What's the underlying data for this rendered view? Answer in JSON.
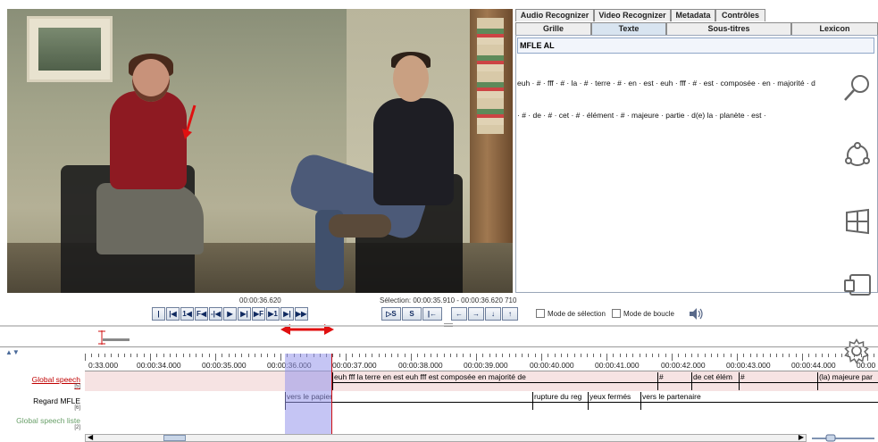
{
  "right_panel": {
    "tabs_top": [
      "Audio Recognizer",
      "Video Recognizer",
      "Metadata",
      "Contrôles"
    ],
    "tabs_second": [
      "Grille",
      "Texte",
      "Sous-titres",
      "Lexicon"
    ],
    "active_tab": "Texte",
    "tier_name": "MFLE AL",
    "transcript_lines": [
      "euh · # · fff · # · la · # · terre · # · en · est · euh · fff · # · est · composée · en · majorité · d",
      "· # · de · # · cet · # · élément · # · majeure · partie · d(e) la · planète · est ·"
    ]
  },
  "player": {
    "current_time": "00:00:36.620",
    "selection": "Sélection: 00:00:35.910 - 00:00:36.620  710",
    "transport_buttons": [
      "|◀◀",
      "|◀",
      "1◀",
      "F◀",
      "-|◀",
      "▶",
      "▶|",
      "▶F",
      "▶1",
      "▶|",
      "▶▶|"
    ],
    "sel_buttons": [
      "▷S",
      "S",
      "|←"
    ],
    "arrow_buttons": [
      "←",
      "→",
      "↓",
      "↑"
    ],
    "mode_selection": "Mode de sélection",
    "mode_loop": "Mode de boucle"
  },
  "timeline": {
    "ruler_labels": [
      "0:33.000",
      "00:00:34.000",
      "00:00:35.000",
      "00:00:36.000",
      "00:00:37.000",
      "00:00:38.000",
      "00:00:39.000",
      "00:00:40.000",
      "00:00:41.000",
      "00:00:42.000",
      "00:00:43.000",
      "00:00:44.000",
      "00:00"
    ],
    "tiers": [
      {
        "name": "Global speech",
        "count": "[5]",
        "color": "#c00000",
        "annotations": [
          "euh fff la terre en est euh fff est composée en majorité de",
          "#",
          "de cet élém",
          "#",
          "(la) majeure par"
        ]
      },
      {
        "name": "Regard MFLE",
        "count": "[6]",
        "color": "#000000",
        "annotations": [
          "vers le papier",
          "rupture du reg",
          "yeux fermés",
          "vers le partenaire"
        ]
      },
      {
        "name": "Global speech liste",
        "count": "[2]",
        "color": "#6aa06a",
        "annotations": []
      }
    ]
  },
  "icons": {
    "search": "search-icon",
    "share": "share-icon",
    "windows": "windows-icon",
    "devices": "devices-icon",
    "settings": "gear-icon"
  }
}
